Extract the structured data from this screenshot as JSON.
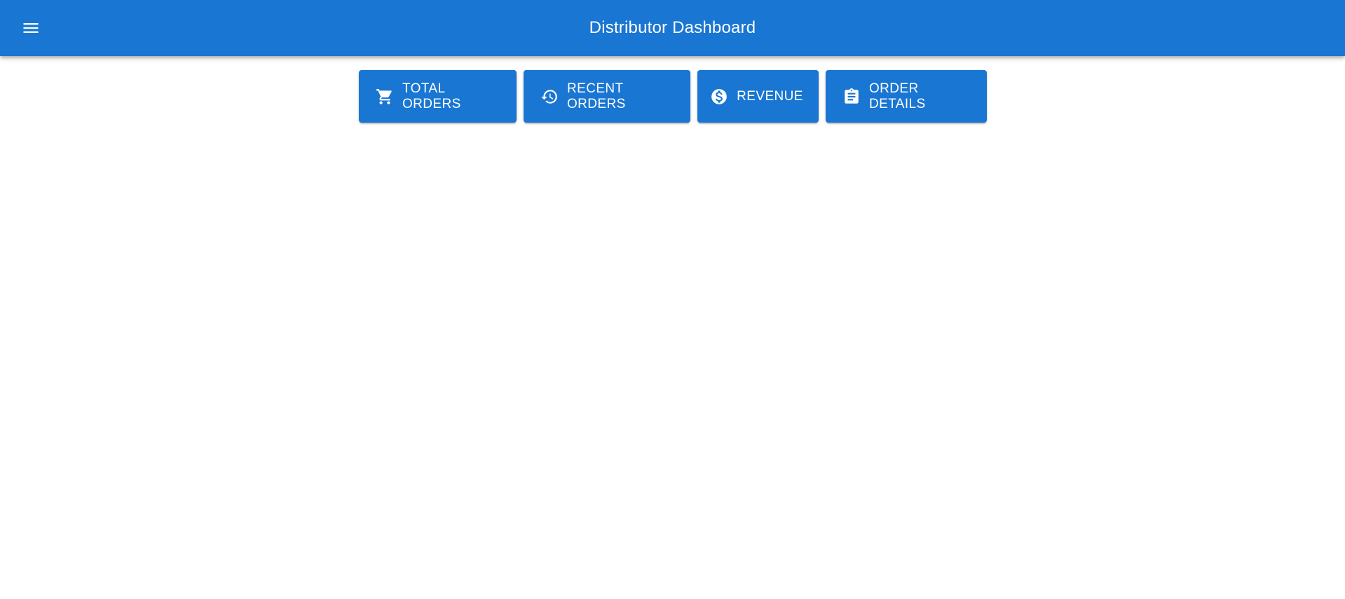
{
  "app_bar": {
    "title": "Distributor Dashboard",
    "menu_icon": "menu-icon",
    "color": "#1976d2"
  },
  "toolbar": {
    "buttons": [
      {
        "label": "TOTAL ORDERS",
        "icon": "cart-icon"
      },
      {
        "label": "RECENT ORDERS",
        "icon": "history-icon"
      },
      {
        "label": "REVENUE",
        "icon": "dollar-circle-icon"
      },
      {
        "label": "ORDER DETAILS",
        "icon": "clipboard-icon"
      }
    ]
  }
}
